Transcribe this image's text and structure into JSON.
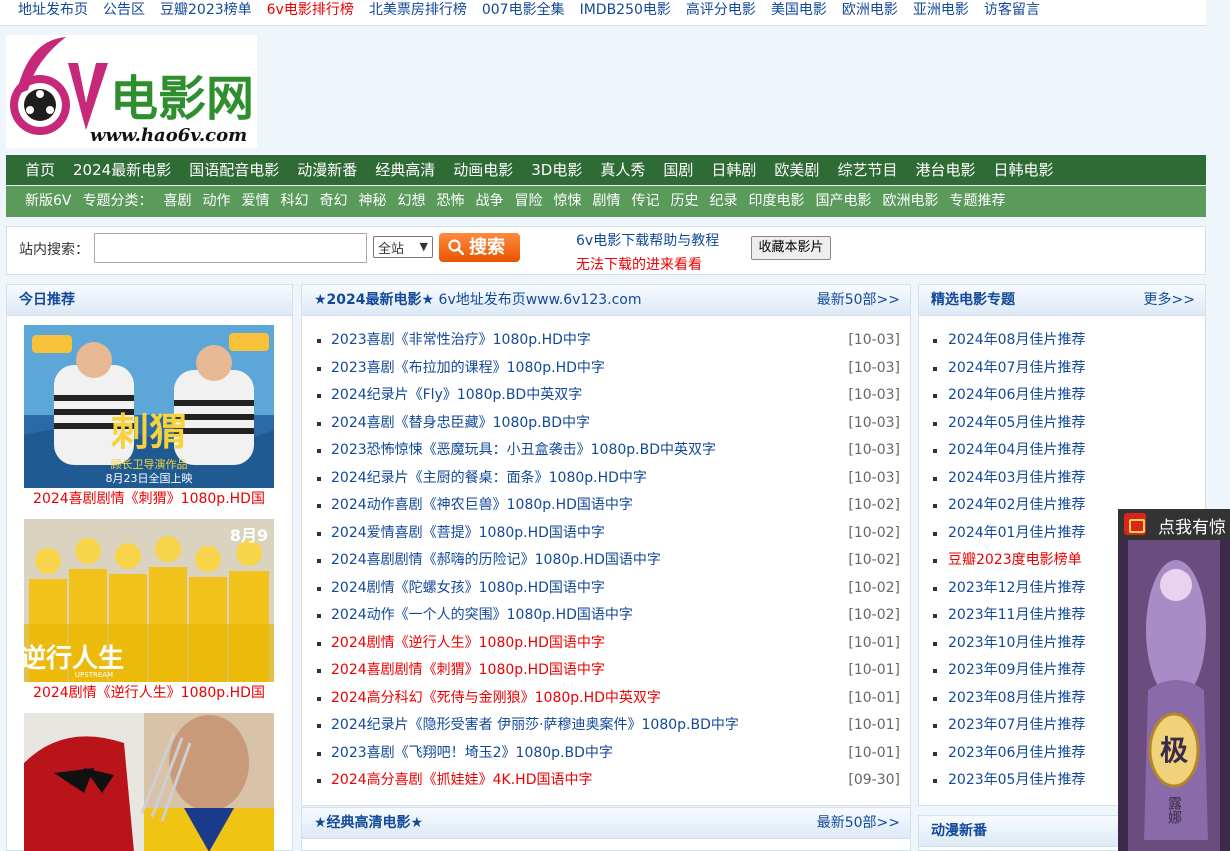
{
  "topbar": {
    "links": [
      {
        "label": "地址发布页",
        "red": false
      },
      {
        "label": "公告区",
        "red": false
      },
      {
        "label": "豆瓣2023榜单",
        "red": false
      },
      {
        "label": "6v电影排行榜",
        "red": true
      },
      {
        "label": "北美票房排行榜",
        "red": false
      },
      {
        "label": "007电影全集",
        "red": false
      },
      {
        "label": "IMDB250电影",
        "red": false
      },
      {
        "label": "高评分电影",
        "red": false
      },
      {
        "label": "美国电影",
        "red": false
      },
      {
        "label": "欧洲电影",
        "red": false
      },
      {
        "label": "亚洲电影",
        "red": false
      },
      {
        "label": "访客留言",
        "red": false
      }
    ]
  },
  "logo": {
    "brand": "电影网",
    "number": "6v",
    "url": "www.hao6v.com"
  },
  "nav_main": [
    "首页",
    "2024最新电影",
    "国语配音电影",
    "动漫新番",
    "经典高清",
    "动画电影",
    "3D电影",
    "真人秀",
    "国剧",
    "日韩剧",
    "欧美剧",
    "综艺节目",
    "港台电影",
    "日韩电影"
  ],
  "nav_sub": [
    "新版6V",
    "专题分类：",
    "喜剧",
    "动作",
    "爱情",
    "科幻",
    "奇幻",
    "神秘",
    "幻想",
    "恐怖",
    "战争",
    "冒险",
    "惊悚",
    "剧情",
    "传记",
    "历史",
    "纪录",
    "印度电影",
    "国产电影",
    "欧洲电影",
    "专题推荐"
  ],
  "search": {
    "label": "站内搜索：",
    "value": "",
    "scope": "全站",
    "button": "搜索",
    "help_link": "6v电影下载帮助与教程",
    "warn_link": "无法下载的进来看看",
    "fav_button": "收藏本影片"
  },
  "today": {
    "title": "今日推荐",
    "items": [
      {
        "caption": "2024喜剧剧情《刺猬》1080p.HD国",
        "poster_title": "刺猬",
        "poster_line1": "顾长卫导演作品",
        "poster_line2": "8月23日全国上映"
      },
      {
        "caption": "2024剧情《逆行人生》1080p.HD国",
        "poster_title": "逆行人生",
        "poster_date": "8月9",
        "poster_tag": "UPSTREAM"
      },
      {
        "caption": "",
        "poster_title": ""
      }
    ]
  },
  "latest": {
    "title": "★2024最新电影★",
    "subtitle": "6v地址发布页www.6v123.com",
    "more": "最新50部>>",
    "items": [
      {
        "title": "2023喜剧《非常性治疗》1080p.HD中字",
        "date": "[10-03]",
        "red": false
      },
      {
        "title": "2023喜剧《布拉加的课程》1080p.HD中字",
        "date": "[10-03]",
        "red": false
      },
      {
        "title": "2024纪录片《Fly》1080p.BD中英双字",
        "date": "[10-03]",
        "red": false
      },
      {
        "title": "2024喜剧《替身忠臣藏》1080p.BD中字",
        "date": "[10-03]",
        "red": false
      },
      {
        "title": "2023恐怖惊悚《恶魔玩具：小丑盒袭击》1080p.BD中英双字",
        "date": "[10-03]",
        "red": false
      },
      {
        "title": "2024纪录片《主厨的餐桌：面条》1080p.HD中字",
        "date": "[10-03]",
        "red": false
      },
      {
        "title": "2024动作喜剧《神农巨兽》1080p.HD国语中字",
        "date": "[10-02]",
        "red": false
      },
      {
        "title": "2024爱情喜剧《菩提》1080p.HD国语中字",
        "date": "[10-02]",
        "red": false
      },
      {
        "title": "2024喜剧剧情《郝嗨的历险记》1080p.HD国语中字",
        "date": "[10-02]",
        "red": false
      },
      {
        "title": "2024剧情《陀螺女孩》1080p.HD国语中字",
        "date": "[10-02]",
        "red": false
      },
      {
        "title": "2024动作《一个人的突围》1080p.HD国语中字",
        "date": "[10-02]",
        "red": false
      },
      {
        "title": "2024剧情《逆行人生》1080p.HD国语中字",
        "date": "[10-01]",
        "red": true
      },
      {
        "title": "2024喜剧剧情《刺猬》1080p.HD国语中字",
        "date": "[10-01]",
        "red": true
      },
      {
        "title": "2024高分科幻《死侍与金刚狼》1080p.HD中英双字",
        "date": "[10-01]",
        "red": true
      },
      {
        "title": "2024纪录片《隐形受害者 伊丽莎·萨穆迪奥案件》1080p.BD中字",
        "date": "[10-01]",
        "red": false
      },
      {
        "title": "2023喜剧《飞翔吧！埼玉2》1080p.BD中字",
        "date": "[10-01]",
        "red": false
      },
      {
        "title": "2024高分喜剧《抓娃娃》4K.HD国语中字",
        "date": "[09-30]",
        "red": true
      }
    ]
  },
  "classic": {
    "title": "★经典高清电影★",
    "more": "最新50部>>"
  },
  "topics": {
    "title": "精选电影专题",
    "more": "更多>>",
    "items": [
      {
        "label": "2024年08月佳片推荐",
        "red": false
      },
      {
        "label": "2024年07月佳片推荐",
        "red": false
      },
      {
        "label": "2024年06月佳片推荐",
        "red": false
      },
      {
        "label": "2024年05月佳片推荐",
        "red": false
      },
      {
        "label": "2024年04月佳片推荐",
        "red": false
      },
      {
        "label": "2024年03月佳片推荐",
        "red": false
      },
      {
        "label": "2024年02月佳片推荐",
        "red": false
      },
      {
        "label": "2024年01月佳片推荐",
        "red": false
      },
      {
        "label": "豆瓣2023度电影榜单",
        "red": true
      },
      {
        "label": "2023年12月佳片推荐",
        "red": false
      },
      {
        "label": "2023年11月佳片推荐",
        "red": false
      },
      {
        "label": "2023年10月佳片推荐",
        "red": false
      },
      {
        "label": "2023年09月佳片推荐",
        "red": false
      },
      {
        "label": "2023年08月佳片推荐",
        "red": false
      },
      {
        "label": "2023年07月佳片推荐",
        "red": false
      },
      {
        "label": "2023年06月佳片推荐",
        "red": false
      },
      {
        "label": "2023年05月佳片推荐",
        "red": false
      }
    ]
  },
  "anime": {
    "title": "动漫新番"
  },
  "ad": {
    "bar_text": "点我有惊",
    "char": "极",
    "name": "露娜"
  },
  "colors": {
    "nav_dark": "#2f6b34",
    "nav_light": "#5a9b5c",
    "link": "#12499a",
    "highlight": "#e00000",
    "search_btn": "#e85400"
  }
}
